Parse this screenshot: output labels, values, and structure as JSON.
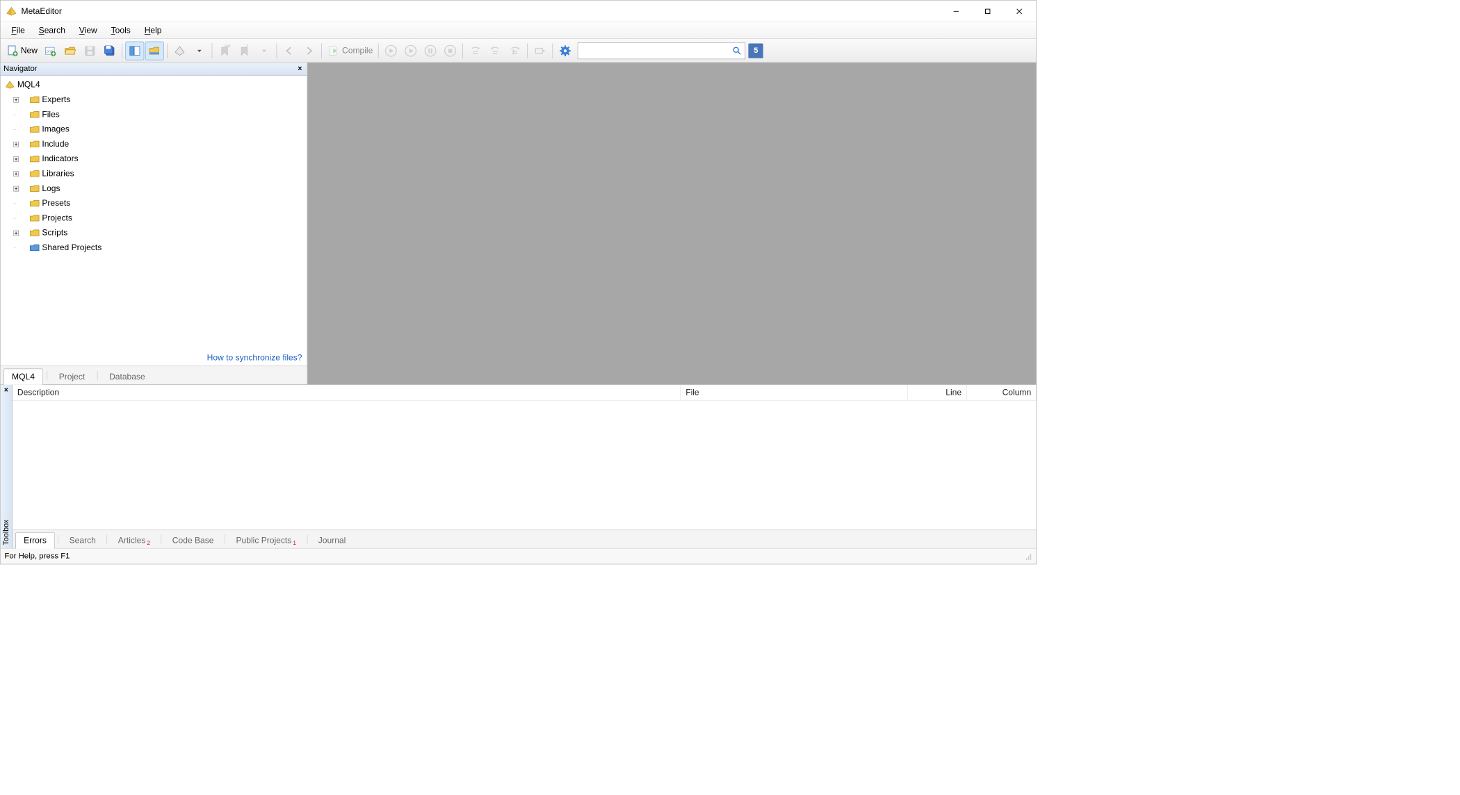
{
  "titlebar": {
    "title": "MetaEditor"
  },
  "menu": {
    "file": "File",
    "search": "Search",
    "view": "View",
    "tools": "Tools",
    "help": "Help"
  },
  "toolbar": {
    "new_label": "New",
    "compile_label": "Compile",
    "search_placeholder": "",
    "mql5_badge": "5"
  },
  "navigator": {
    "title": "Navigator",
    "root": "MQL4",
    "items": [
      {
        "label": "Experts",
        "expandable": true
      },
      {
        "label": "Files",
        "expandable": false
      },
      {
        "label": "Images",
        "expandable": false
      },
      {
        "label": "Include",
        "expandable": true
      },
      {
        "label": "Indicators",
        "expandable": true
      },
      {
        "label": "Libraries",
        "expandable": true
      },
      {
        "label": "Logs",
        "expandable": true
      },
      {
        "label": "Presets",
        "expandable": false
      },
      {
        "label": "Projects",
        "expandable": false
      },
      {
        "label": "Scripts",
        "expandable": true
      },
      {
        "label": "Shared Projects",
        "expandable": false,
        "shared": true
      }
    ],
    "sync_link": "How to synchronize files?",
    "tabs": {
      "mql4": "MQL4",
      "project": "Project",
      "database": "Database"
    }
  },
  "toolbox": {
    "title": "Toolbox",
    "columns": {
      "description": "Description",
      "file": "File",
      "line": "Line",
      "column": "Column"
    },
    "tabs": {
      "errors": "Errors",
      "search": "Search",
      "articles": "Articles",
      "articles_badge": "2",
      "codebase": "Code Base",
      "public_projects": "Public Projects",
      "public_projects_badge": "1",
      "journal": "Journal"
    }
  },
  "statusbar": {
    "text": "For Help, press F1"
  }
}
